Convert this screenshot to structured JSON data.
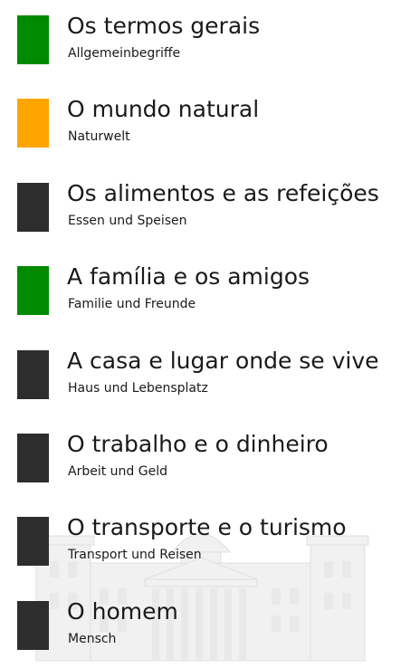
{
  "colors": {
    "green": "#008a00",
    "orange": "#ffa500",
    "dark": "#2d2d2d"
  },
  "items": [
    {
      "title": "Os termos gerais",
      "subtitle": "Allgemeinbegriffe",
      "tile_color": "#008a00"
    },
    {
      "title": "O mundo natural",
      "subtitle": "Naturwelt",
      "tile_color": "#ffa500"
    },
    {
      "title": "Os alimentos e as refeições",
      "subtitle": "Essen und Speisen",
      "tile_color": "#2d2d2d"
    },
    {
      "title": "A família e os amigos",
      "subtitle": "Familie und Freunde",
      "tile_color": "#008a00"
    },
    {
      "title": "A casa e lugar onde se vive",
      "subtitle": "Haus und Lebensplatz",
      "tile_color": "#2d2d2d"
    },
    {
      "title": "O trabalho e o dinheiro",
      "subtitle": "Arbeit und Geld",
      "tile_color": "#2d2d2d"
    },
    {
      "title": "O transporte e o turismo",
      "subtitle": "Transport und Reisen",
      "tile_color": "#2d2d2d"
    },
    {
      "title": "O homem",
      "subtitle": "Mensch",
      "tile_color": "#2d2d2d"
    }
  ]
}
